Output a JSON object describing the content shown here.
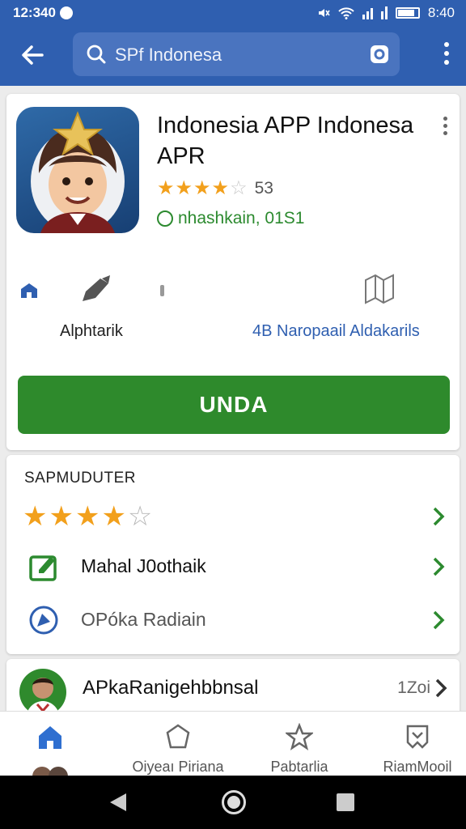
{
  "status_bar": {
    "time": "12:340",
    "clock_right": "8:40"
  },
  "search": {
    "query": "SPf Indonesa"
  },
  "app": {
    "name": "Indonesia APP Indonesa APR",
    "rating_count": "53",
    "developer": "nhashkain, 01S1",
    "feature_left_label": "Alphtarik",
    "feature_right_label": "4B Naropaail Aldakarils",
    "install_label": "UNDA"
  },
  "details": {
    "section_title": "SAPMUDUTER",
    "rows": [
      {
        "label": "Mahal J0othaik"
      },
      {
        "label": "OPóka Radiain"
      }
    ]
  },
  "review": {
    "name": "APkaRanigehbbnsal",
    "date": "1Zoi"
  },
  "bottom_nav": {
    "items": [
      {
        "label": ""
      },
      {
        "label": "Oiyeaı Piriana"
      },
      {
        "label": "Pabtarlia"
      },
      {
        "label": "RiamMooil"
      }
    ]
  },
  "colors": {
    "brand": "#2f5fb0",
    "install": "#2e8a2c",
    "star": "#f2a01c"
  },
  "icons": [
    "back-arrow-icon",
    "search-icon",
    "lens-icon",
    "more-vert-icon",
    "home-icon",
    "pen-icon",
    "book-icon",
    "star-icon",
    "chevron-right-icon",
    "edit-square-icon",
    "compass-icon",
    "pentagon-icon",
    "star-outline-icon",
    "ribbon-icon"
  ]
}
